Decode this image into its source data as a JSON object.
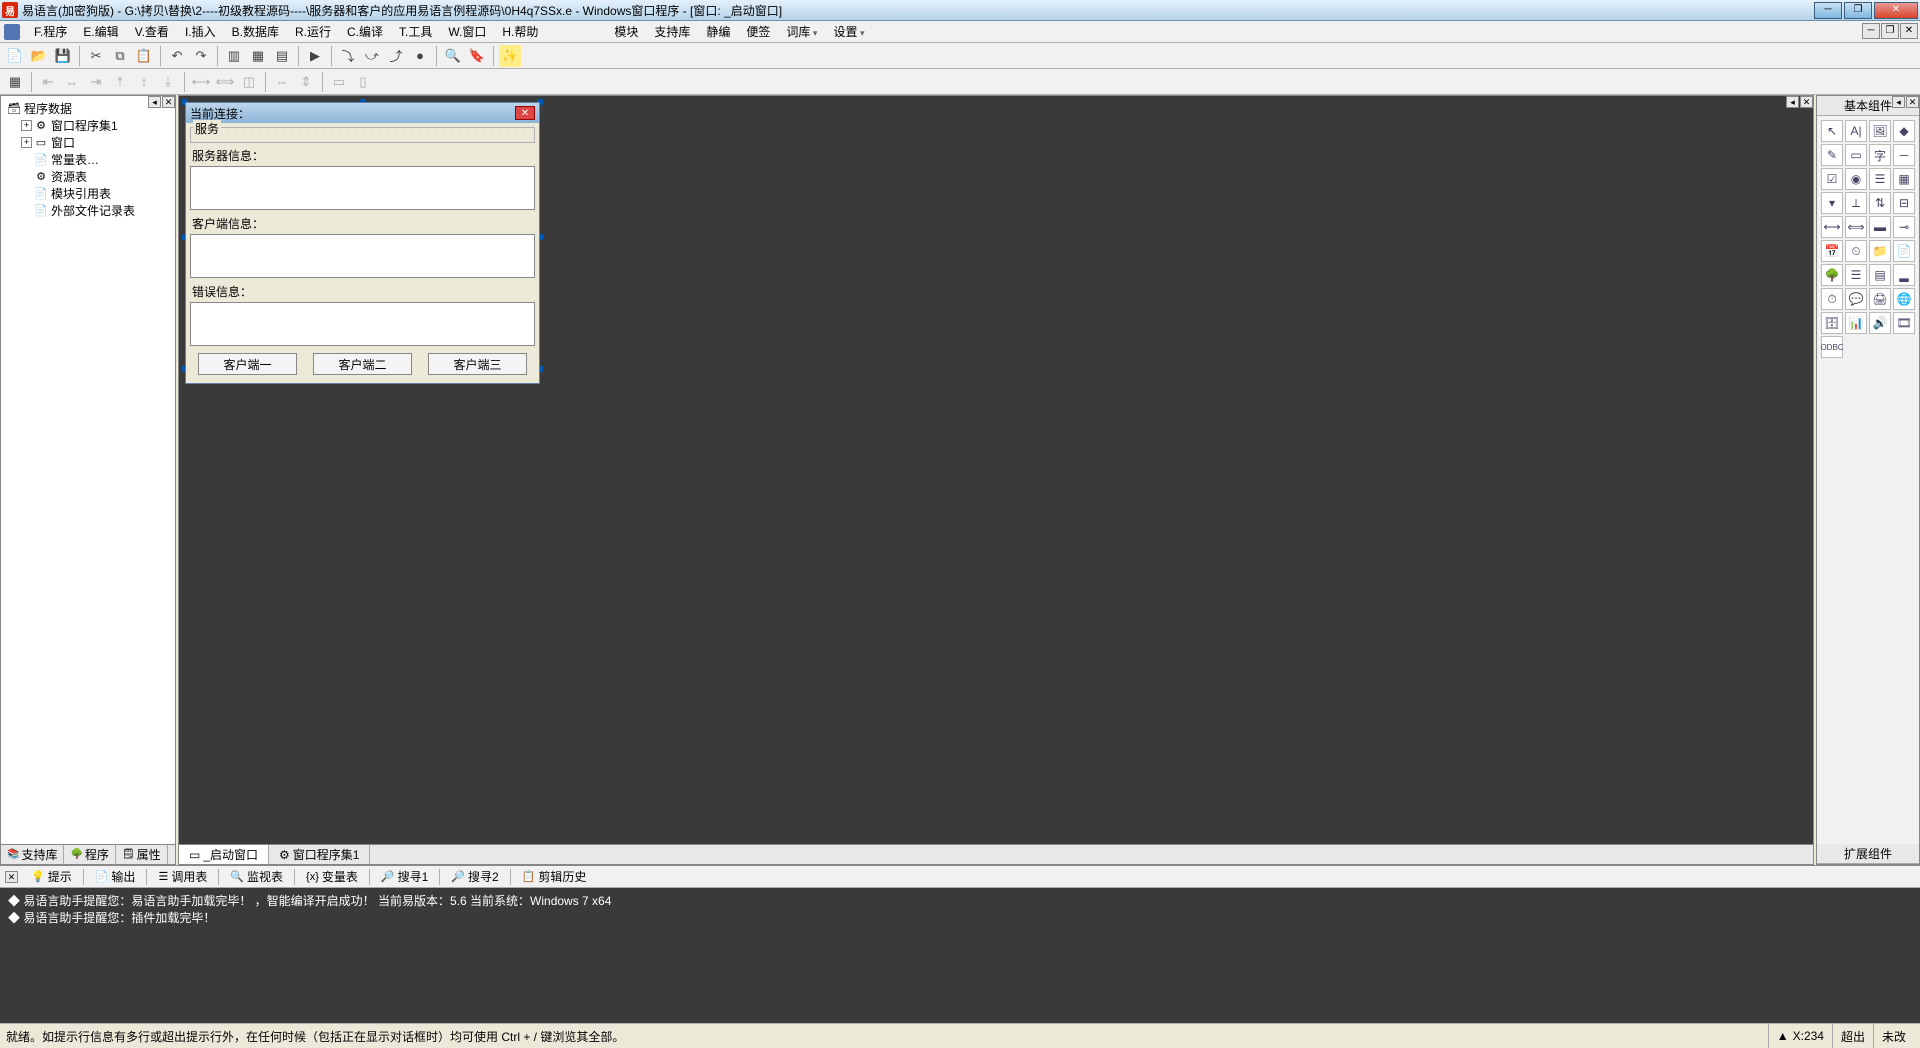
{
  "title": "易语言(加密狗版) - G:\\拷贝\\替换\\2----初级教程源码----\\服务器和客户的应用易语言例程源码\\0H4q7SSx.e - Windows窗口程序 - [窗口: _启动窗口]",
  "menu": {
    "file": "F.程序",
    "edit": "E.编辑",
    "view": "V.查看",
    "insert": "I.插入",
    "db": "B.数据库",
    "run": "R.运行",
    "compile": "C.编译",
    "tool": "T.工具",
    "window": "W.窗口",
    "help": "H.帮助",
    "module": "模块",
    "support": "支持库",
    "static": "静编",
    "portable": "便签",
    "dict": "词库",
    "setting": "设置"
  },
  "tree": {
    "root": "程序数据",
    "items": [
      "窗口程序集1",
      "窗口",
      "常量表…",
      "资源表",
      "模块引用表",
      "外部文件记录表"
    ]
  },
  "leftTabs": [
    "支持库",
    "程序",
    "属性"
  ],
  "form": {
    "title": "当前连接：",
    "grp_service": "服务",
    "lbl_server": "服务器信息：",
    "lbl_client": "客户端信息：",
    "lbl_error": "错误信息：",
    "btn1": "客户端一",
    "btn2": "客户端二",
    "btn3": "客户端三"
  },
  "centerTabs": {
    "startup": "_启动窗口",
    "set": "窗口程序集1"
  },
  "palette": {
    "basic": "基本组件",
    "ext": "扩展组件"
  },
  "output": {
    "tabs": [
      "提示",
      "输出",
      "调用表",
      "监视表",
      "变量表",
      "搜寻1",
      "搜寻2",
      "剪辑历史"
    ],
    "lines": [
      "易语言助手提醒您：易语言助手加载完毕！ ，智能编译开启成功！ 当前易版本：5.6  当前系统：Windows 7 x64",
      "易语言助手提醒您：插件加载完毕！"
    ]
  },
  "status": {
    "msg": "就绪。如提示行信息有多行或超出提示行外，在任何时候（包括正在显示对话框时）均可使用 Ctrl + / 键浏览其全部。",
    "coord": "X:234",
    "overwrite": "超出",
    "modified": "未改"
  }
}
